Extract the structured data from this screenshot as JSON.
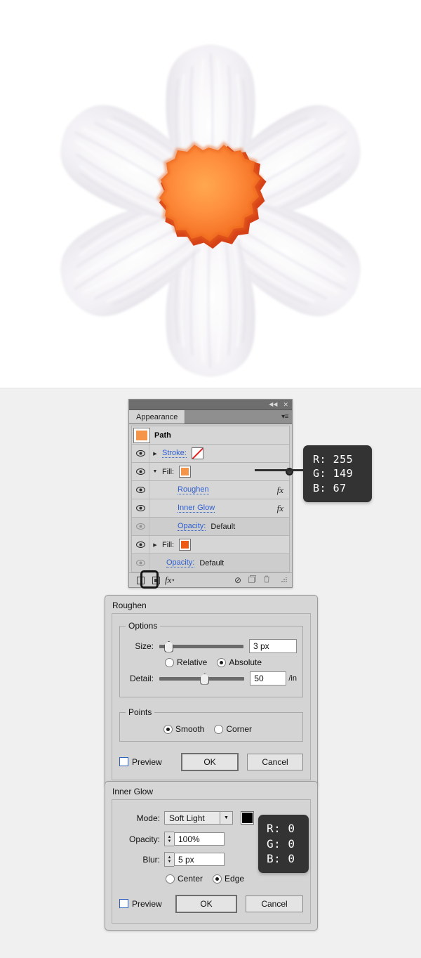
{
  "artwork": {
    "name": "daffodil-flower-illustration",
    "petal_count": 6,
    "petal_color": "#f2f0f4",
    "center_outer_color": "#d93b10",
    "center_inner_color": "#ff8a2a",
    "center_highlight_color": "#ff9d43"
  },
  "panel": {
    "title": "Appearance",
    "titlebar": {
      "collapse_icon": "◀◀",
      "close_icon": "✕",
      "menu_icon": "▾≡"
    },
    "target_row": {
      "label": "Path",
      "thumbnail_color": "#f5954a"
    },
    "rows": [
      {
        "label": "Stroke:",
        "type": "stroke",
        "eye": true,
        "disclosure": "▶",
        "swatch": "none",
        "fx": false
      },
      {
        "label": "Fill:",
        "type": "fill",
        "eye": true,
        "disclosure": "▼",
        "swatch_color": "#f5954a",
        "fx": false
      },
      {
        "label": "Roughen",
        "type": "effect",
        "eye": true,
        "fx": true,
        "fx_label": "fx"
      },
      {
        "label": "Inner Glow",
        "type": "effect",
        "eye": true,
        "fx": true,
        "fx_label": "fx"
      },
      {
        "label": "Opacity:",
        "value": "Default",
        "type": "opacity",
        "eye": false,
        "fx": false
      },
      {
        "label": "Fill:",
        "type": "fill",
        "eye": true,
        "disclosure": "▶",
        "swatch_color": "#ef5a12",
        "fx": false
      },
      {
        "label": "Opacity:",
        "value": "Default",
        "type": "opacity",
        "eye": false,
        "fx": false
      }
    ],
    "footer": {
      "add_stroke": "add-new-stroke",
      "add_fill": "add-new-fill",
      "fx_label": "fx",
      "fx_caret": "▾",
      "clear": "⊘",
      "duplicate": "❐",
      "delete": "🗑",
      "grip": "resize-grip"
    }
  },
  "callout_fill": {
    "r_label": "R:",
    "r_value": "255",
    "g_label": "G:",
    "g_value": "149",
    "b_label": "B:",
    "b_value": "67"
  },
  "roughen_dialog": {
    "title": "Roughen",
    "options_group": "Options",
    "size_label": "Size:",
    "size_value": "3 px",
    "size_slider_pct": 6,
    "relative_label": "Relative",
    "absolute_label": "Absolute",
    "size_mode": "Absolute",
    "detail_label": "Detail:",
    "detail_value": "50",
    "detail_unit": "/in",
    "detail_slider_pct": 48,
    "points_group": "Points",
    "smooth_label": "Smooth",
    "corner_label": "Corner",
    "points_mode": "Smooth",
    "preview_label": "Preview",
    "preview_checked": false,
    "ok_label": "OK",
    "cancel_label": "Cancel"
  },
  "inner_glow_dialog": {
    "title": "Inner Glow",
    "mode_label": "Mode:",
    "mode_value": "Soft Light",
    "color_swatch": "#000000",
    "opacity_label": "Opacity:",
    "opacity_value": "100%",
    "blur_label": "Blur:",
    "blur_value": "5 px",
    "center_label": "Center",
    "edge_label": "Edge",
    "origin": "Edge",
    "preview_label": "Preview",
    "preview_checked": false,
    "ok_label": "OK",
    "cancel_label": "Cancel"
  },
  "callout_glow": {
    "r_label": "R:",
    "r_value": "0",
    "g_label": "G:",
    "g_value": "0",
    "b_label": "B:",
    "b_value": "0"
  }
}
